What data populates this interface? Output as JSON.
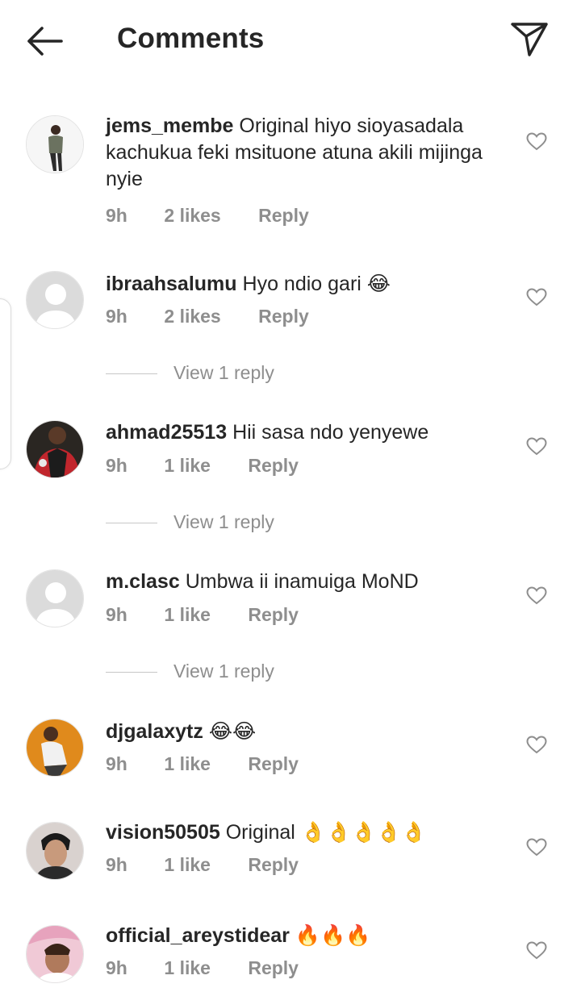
{
  "header": {
    "title": "Comments",
    "back_icon": "arrow-left-icon",
    "send_icon": "paper-plane-icon"
  },
  "comments": [
    {
      "username": "jems_membe",
      "text": "Original hiyo sioyasadala kachukua feki msituone atuna akili mijinga nyie",
      "emoji": "",
      "time": "9h",
      "likes": "2 likes",
      "reply": "Reply",
      "view_replies": "",
      "avatar": "photo-person-standing"
    },
    {
      "username": "ibraahsalumu",
      "text": "Hyo ndio gari",
      "emoji": "😂",
      "time": "9h",
      "likes": "2 likes",
      "reply": "Reply",
      "view_replies": "View 1 reply",
      "avatar": "default-avatar"
    },
    {
      "username": "ahmad25513",
      "text": "Hii sasa ndo yenyewe",
      "emoji": "",
      "time": "9h",
      "likes": "1 like",
      "reply": "Reply",
      "view_replies": "View 1 reply",
      "avatar": "photo-person-jersey"
    },
    {
      "username": "m.clasc",
      "text": "Umbwa ii inamuiga MoND",
      "emoji": "",
      "time": "9h",
      "likes": "1 like",
      "reply": "Reply",
      "view_replies": "View 1 reply",
      "avatar": "default-avatar"
    },
    {
      "username": "djgalaxytz",
      "text": "",
      "emoji": "😂😂",
      "time": "9h",
      "likes": "1 like",
      "reply": "Reply",
      "view_replies": "",
      "avatar": "photo-person-orange"
    },
    {
      "username": "vision50505",
      "text": "Original",
      "emoji": "👌👌👌👌👌",
      "time": "9h",
      "likes": "1 like",
      "reply": "Reply",
      "view_replies": "",
      "avatar": "photo-woman-portrait"
    },
    {
      "username": "official_areystidear",
      "text": "",
      "emoji": "🔥🔥🔥",
      "time": "9h",
      "likes": "1 like",
      "reply": "Reply",
      "view_replies": "",
      "avatar": "photo-woman-pink"
    }
  ],
  "colors": {
    "text": "#262626",
    "secondary": "#8e8e8e",
    "default_avatar_bg": "#dbdbdb",
    "divider": "#c7c7c7"
  }
}
